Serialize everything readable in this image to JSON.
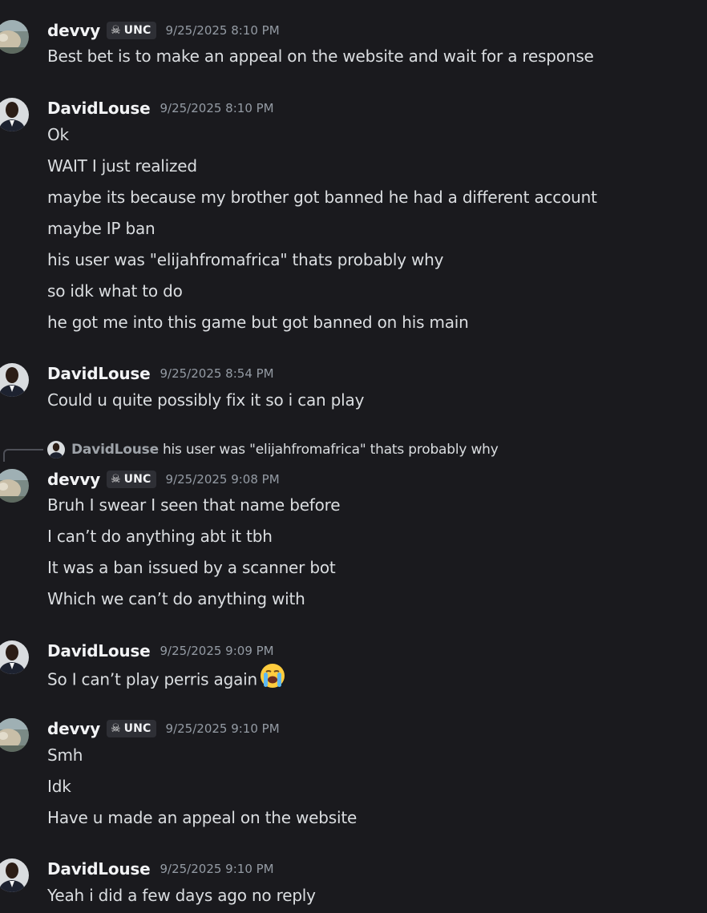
{
  "colors": {
    "background": "#1a1a1e",
    "username": "#f2f3f5",
    "message_text": "#dbdee1",
    "timestamp": "#949ba4",
    "tag_background": "#2e2f35"
  },
  "messages": [
    {
      "author": "devvy",
      "tag": {
        "icon": "skull-icon",
        "label": "UNC"
      },
      "timestamp": "9/25/2025 8:10 PM",
      "lines": [
        "Best bet is to make an appeal on the website and wait for a response"
      ]
    },
    {
      "author": "DavidLouse",
      "timestamp": "9/25/2025 8:10 PM",
      "lines": [
        "Ok",
        "WAIT I just realized",
        "maybe its because my brother got banned he had a different account",
        "maybe IP ban",
        "his user was \"elijahfromafrica\" thats probably why",
        "so idk what to do",
        "he got me into this game but got banned on his main"
      ]
    },
    {
      "author": "DavidLouse",
      "timestamp": "9/25/2025 8:54 PM",
      "lines": [
        "Could u quite possibly fix it so i can play"
      ]
    },
    {
      "reply_to": {
        "author": "DavidLouse",
        "content": "his user was \"elijahfromafrica\" thats probably why"
      },
      "author": "devvy",
      "tag": {
        "icon": "skull-icon",
        "label": "UNC"
      },
      "timestamp": "9/25/2025 9:08 PM",
      "lines": [
        "Bruh I swear I seen that name before",
        "I can’t do anything abt it tbh",
        "It was a ban issued by a scanner bot",
        "Which we can’t do anything with"
      ]
    },
    {
      "author": "DavidLouse",
      "timestamp": "9/25/2025 9:09 PM",
      "lines": [
        "So I can’t play perris again"
      ],
      "emoji": "loudly-crying-face-icon"
    },
    {
      "author": "devvy",
      "tag": {
        "icon": "skull-icon",
        "label": "UNC"
      },
      "timestamp": "9/25/2025 9:10 PM",
      "lines": [
        "Smh",
        "Idk",
        "Have u made an appeal on the website"
      ]
    },
    {
      "author": "DavidLouse",
      "timestamp": "9/25/2025 9:10 PM",
      "lines": [
        "Yeah i did a few days ago no reply"
      ]
    }
  ]
}
